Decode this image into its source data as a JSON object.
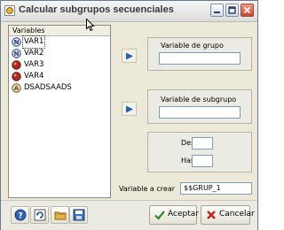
{
  "window": {
    "title": "Calcular subgrupos secuenciales"
  },
  "variables": {
    "header": "Variables",
    "items": [
      {
        "label": "VAR1",
        "icon": "numeric-var-icon"
      },
      {
        "label": "VAR2",
        "icon": "numeric-var-icon"
      },
      {
        "label": "VAR3",
        "icon": "red-var-icon"
      },
      {
        "label": "VAR4",
        "icon": "red-var-icon"
      },
      {
        "label": "DSADSAADS",
        "icon": "alpha-var-icon"
      }
    ]
  },
  "group_var": {
    "label": "Variable de grupo",
    "value": ""
  },
  "subgroup_var": {
    "label": "Variable de subgrupo",
    "value": ""
  },
  "range": {
    "from_label": "Desde :",
    "from_value": "",
    "to_label": "Hasta :",
    "to_value": ""
  },
  "create_var": {
    "label": "Variable a crear",
    "value": "$$GRUP_1"
  },
  "buttons": {
    "accept": "Aceptar",
    "cancel": "Cancelar"
  },
  "colors": {
    "arrow_blue": "#2b5fb0",
    "close_red": "#c7462e",
    "accept_green": "#2c8a2c",
    "cancel_red": "#c0201a"
  }
}
